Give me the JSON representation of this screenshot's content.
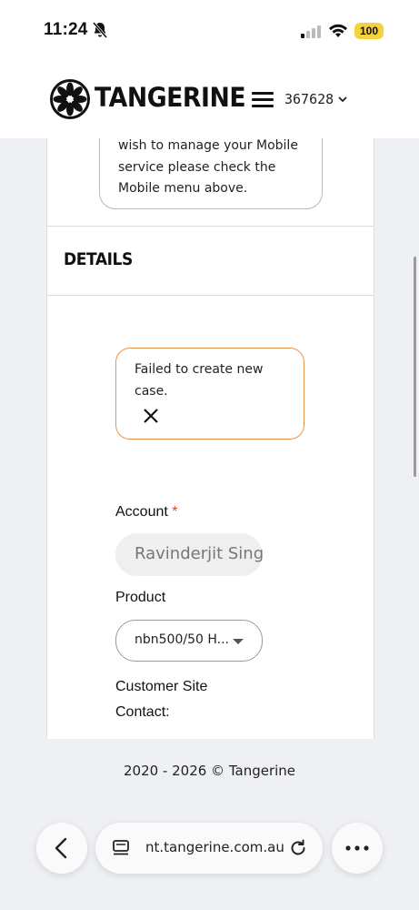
{
  "status_bar": {
    "time": "11:24",
    "battery": "100"
  },
  "header": {
    "logo_text": "TANGERINE",
    "account_number": "367628"
  },
  "info_box": {
    "text": "wish to manage your Mobile service please check the Mobile menu above."
  },
  "details": {
    "heading": "DETAILS"
  },
  "error": {
    "message": "Failed to create new case."
  },
  "form": {
    "account_label": "Account",
    "required_mark": "*",
    "account_value": "Ravinderjit Singh",
    "product_label": "Product",
    "product_value": "nbn500/50 H...",
    "contact_label": "Customer Site Contact:"
  },
  "footer": {
    "copyright": "2020 - 2026 © Tangerine"
  },
  "browser": {
    "url": "nt.tangerine.com.au"
  },
  "colors": {
    "accent_orange": "#e8954a",
    "required_red": "#d24b1f",
    "battery_yellow": "#f4d23b"
  }
}
